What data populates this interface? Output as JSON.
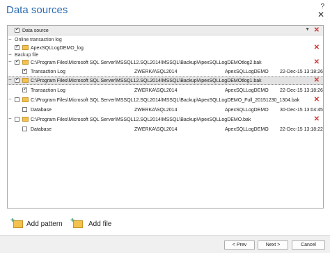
{
  "window": {
    "title": "Data sources",
    "help_glyph": "?",
    "close_glyph": "✕"
  },
  "header": {
    "label": "Data source",
    "filter_icon": "funnel-icon",
    "delete_icon": "delete-x-icon"
  },
  "groups": {
    "online": {
      "label": "Online transaction log"
    },
    "backup": {
      "label": "Backup file"
    }
  },
  "online_items": [
    {
      "name": "ApexSQLLogDEMO_log",
      "checked": true
    }
  ],
  "backup_items": [
    {
      "path": "C:\\Program Files\\Microsoft SQL Server\\MSSQL12.SQL2014\\MSSQL\\Backup\\ApexSQLLogDEMOtlog2.bak",
      "checked": true,
      "selected": false,
      "child": {
        "type": "Transaction Log",
        "server": "ZWERKA\\SQL2014",
        "database": "ApexSQLLogDEMO",
        "date": "22-Dec-15 13:18:26",
        "checked": true
      }
    },
    {
      "path": "C:\\Program Files\\Microsoft SQL Server\\MSSQL12.SQL2014\\MSSQL\\Backup\\ApexSQLLogDEMOtlog1.bak",
      "checked": true,
      "selected": true,
      "child": {
        "type": "Transaction Log",
        "server": "ZWERKA\\SQL2014",
        "database": "ApexSQLLogDEMO",
        "date": "22-Dec-15 13:18:26",
        "checked": true
      }
    },
    {
      "path": "C:\\Program Files\\Microsoft SQL Server\\MSSQL12.SQL2014\\MSSQL\\Backup\\ApexSQLLogDEMO_Full_20151230_1304.bak",
      "checked": false,
      "selected": false,
      "child": {
        "type": "Database",
        "server": "ZWERKA\\SQL2014",
        "database": "ApexSQLLogDEMO",
        "date": "30-Dec-15 13:04:45",
        "checked": false
      }
    },
    {
      "path": "C:\\Program Files\\Microsoft SQL Server\\MSSQL12.SQL2014\\MSSQL\\Backup\\ApexSQLLogDEMO.bak",
      "checked": false,
      "selected": false,
      "child": {
        "type": "Database",
        "server": "ZWERKA\\SQL2014",
        "database": "ApexSQLLogDEMO",
        "date": "22-Dec-15 13:18:22",
        "checked": false
      }
    }
  ],
  "actions": {
    "add_pattern": "Add pattern",
    "add_file": "Add file"
  },
  "footer": {
    "prev": "< Prev",
    "next": "Next >",
    "cancel": "Cancel"
  },
  "colors": {
    "title": "#2b6cb0",
    "delete": "#d0312d",
    "folder": "#f2c14e",
    "plus": "#2e8b57"
  }
}
